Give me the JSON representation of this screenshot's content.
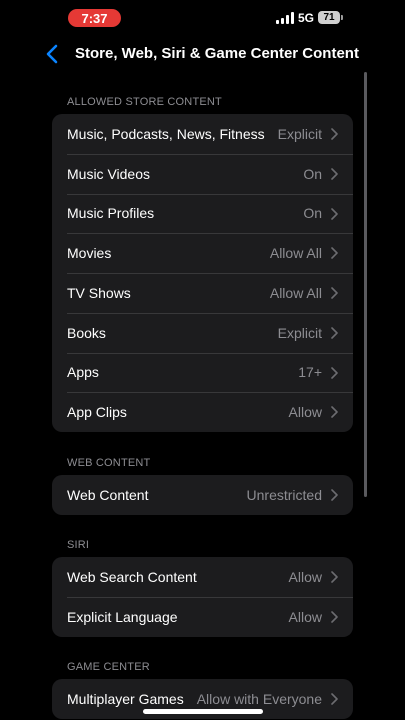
{
  "status": {
    "time": "7:37",
    "network": "5G",
    "battery": "71"
  },
  "nav": {
    "title": "Store, Web, Siri & Game Center Content"
  },
  "icons": {
    "back": "chevron-left-icon",
    "row": "chevron-right-icon"
  },
  "colors": {
    "accent": "#0a84ff",
    "time_pill": "#e53935",
    "group_bg": "#1c1c1e",
    "secondary_text": "#8d8d92"
  },
  "sections": {
    "store": {
      "header": "ALLOWED STORE CONTENT",
      "rows": [
        {
          "label": "Music, Podcasts, News, Fitness",
          "value": "Explicit"
        },
        {
          "label": "Music Videos",
          "value": "On"
        },
        {
          "label": "Music Profiles",
          "value": "On"
        },
        {
          "label": "Movies",
          "value": "Allow All"
        },
        {
          "label": "TV Shows",
          "value": "Allow All"
        },
        {
          "label": "Books",
          "value": "Explicit"
        },
        {
          "label": "Apps",
          "value": "17+"
        },
        {
          "label": "App Clips",
          "value": "Allow"
        }
      ]
    },
    "web": {
      "header": "WEB CONTENT",
      "rows": [
        {
          "label": "Web Content",
          "value": "Unrestricted"
        }
      ]
    },
    "siri": {
      "header": "SIRI",
      "rows": [
        {
          "label": "Web Search Content",
          "value": "Allow"
        },
        {
          "label": "Explicit Language",
          "value": "Allow"
        }
      ]
    },
    "game": {
      "header": "GAME CENTER",
      "rows": [
        {
          "label": "Multiplayer Games",
          "value": "Allow with Everyone"
        }
      ]
    }
  }
}
